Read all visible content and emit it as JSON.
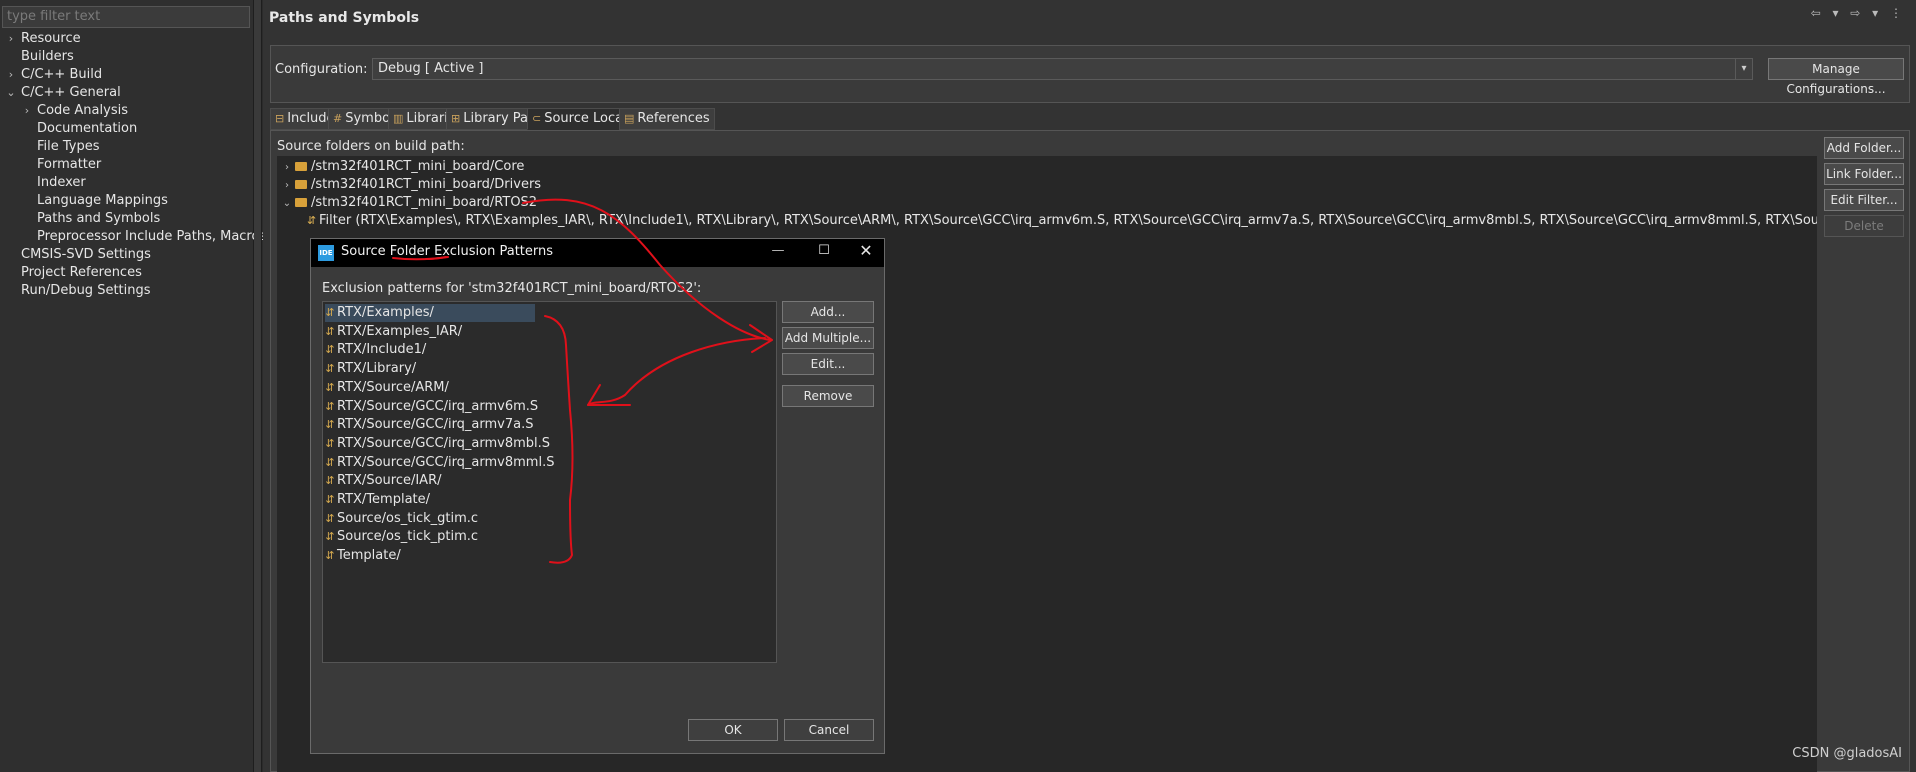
{
  "left_panel": {
    "filter_placeholder": "type filter text",
    "items": [
      {
        "label": "Resource",
        "level": 0,
        "twisty": "›"
      },
      {
        "label": "Builders",
        "level": 0,
        "twisty": ""
      },
      {
        "label": "C/C++ Build",
        "level": 0,
        "twisty": "›"
      },
      {
        "label": "C/C++ General",
        "level": 0,
        "twisty": "⌄"
      },
      {
        "label": "Code Analysis",
        "level": 1,
        "twisty": "›"
      },
      {
        "label": "Documentation",
        "level": 1,
        "twisty": ""
      },
      {
        "label": "File Types",
        "level": 1,
        "twisty": ""
      },
      {
        "label": "Formatter",
        "level": 1,
        "twisty": ""
      },
      {
        "label": "Indexer",
        "level": 1,
        "twisty": ""
      },
      {
        "label": "Language Mappings",
        "level": 1,
        "twisty": ""
      },
      {
        "label": "Paths and Symbols",
        "level": 1,
        "twisty": ""
      },
      {
        "label": "Preprocessor Include Paths, Macros et",
        "level": 1,
        "twisty": ""
      },
      {
        "label": "CMSIS-SVD Settings",
        "level": 0,
        "twisty": ""
      },
      {
        "label": "Project References",
        "level": 0,
        "twisty": ""
      },
      {
        "label": "Run/Debug Settings",
        "level": 0,
        "twisty": ""
      }
    ]
  },
  "page": {
    "title": "Paths and Symbols",
    "nav_icons": "⇦ ▾ ⇨ ▾ ⋮"
  },
  "configuration": {
    "label": "Configuration:",
    "value": "Debug  [ Active ]",
    "manage_button": "Manage Configurations..."
  },
  "tabs": [
    {
      "label": "Includes",
      "icon": "⊟"
    },
    {
      "label": "Symbols",
      "icon": "#"
    },
    {
      "label": "Libraries",
      "icon": "▥"
    },
    {
      "label": "Library Paths",
      "icon": "⊞"
    },
    {
      "label": "Source Location",
      "icon": "⊂",
      "active": true
    },
    {
      "label": "References",
      "icon": "▤"
    }
  ],
  "source_location": {
    "label": "Source folders on build path:",
    "rows": [
      {
        "twisty": "›",
        "text": "/stm32f401RCT_mini_board/Core",
        "kind": "folder"
      },
      {
        "twisty": "›",
        "text": "/stm32f401RCT_mini_board/Drivers",
        "kind": "folder"
      },
      {
        "twisty": "⌄",
        "text": "/stm32f401RCT_mini_board/RTOS2",
        "kind": "folder"
      },
      {
        "twisty": "",
        "text": "Filter (RTX\\Examples\\, RTX\\Examples_IAR\\, RTX\\Include1\\, RTX\\Library\\, RTX\\Source\\ARM\\, RTX\\Source\\GCC\\irq_armv6m.S, RTX\\Source\\GCC\\irq_armv7a.S, RTX\\Source\\GCC\\irq_armv8mbl.S, RTX\\Source\\GCC\\irq_armv8mml.S, RTX\\Source\\IAR\\, RTX\\Template\\, So",
        "kind": "filter"
      }
    ],
    "buttons": {
      "add_folder": "Add Folder...",
      "link_folder": "Link Folder...",
      "edit_filter": "Edit Filter...",
      "delete": "Delete"
    }
  },
  "dialog": {
    "logo": "IDE",
    "title": "Source Folder Exclusion Patterns",
    "min": "—",
    "max": "☐",
    "close": "✕",
    "label": "Exclusion patterns for 'stm32f401RCT_mini_board/RTOS2':",
    "patterns": [
      "RTX/Examples/",
      "RTX/Examples_IAR/",
      "RTX/Include1/",
      "RTX/Library/",
      "RTX/Source/ARM/",
      "RTX/Source/GCC/irq_armv6m.S",
      "RTX/Source/GCC/irq_armv7a.S",
      "RTX/Source/GCC/irq_armv8mbl.S",
      "RTX/Source/GCC/irq_armv8mml.S",
      "RTX/Source/IAR/",
      "RTX/Template/",
      "Source/os_tick_gtim.c",
      "Source/os_tick_ptim.c",
      "Template/"
    ],
    "buttons": {
      "add": "Add...",
      "add_multiple": "Add Multiple...",
      "edit": "Edit...",
      "remove": "Remove",
      "ok": "OK",
      "cancel": "Cancel"
    }
  },
  "watermark": "CSDN @gladosAI",
  "colors": {
    "annotation": "#e0101a",
    "folder": "#d8a13a",
    "selection": "#3a4b5c"
  }
}
